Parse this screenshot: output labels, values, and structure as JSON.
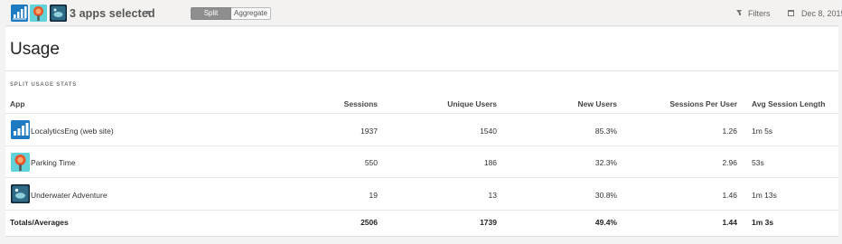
{
  "topbar": {
    "apps_label": "3 apps selected",
    "split_label": "Split",
    "aggregate_label": "Aggregate",
    "filters_label": "Filters",
    "date_label": "Dec 8, 2015"
  },
  "page": {
    "title": "Usage",
    "section_label": "SPLIT USAGE STATS"
  },
  "table": {
    "headers": [
      "App",
      "Sessions",
      "Unique Users",
      "New Users",
      "Sessions Per User",
      "Avg Session Length"
    ],
    "rows": [
      {
        "app": "LocalyticsEng (web site)",
        "icon": "localytics-bars-icon",
        "sessions": "1937",
        "unique_users": "1540",
        "new_users": "85.3%",
        "sessions_per_user": "1.26",
        "avg_session_length": "1m 5s"
      },
      {
        "app": "Parking Time",
        "icon": "parking-meter-icon",
        "sessions": "550",
        "unique_users": "186",
        "new_users": "32.3%",
        "sessions_per_user": "2.96",
        "avg_session_length": "53s"
      },
      {
        "app": "Underwater Adventure",
        "icon": "underwater-game-icon",
        "sessions": "19",
        "unique_users": "13",
        "new_users": "30.8%",
        "sessions_per_user": "1.46",
        "avg_session_length": "1m 13s"
      }
    ],
    "totals": {
      "app": "Totals/Averages",
      "sessions": "2506",
      "unique_users": "1739",
      "new_users": "49.4%",
      "sessions_per_user": "1.44",
      "avg_session_length": "1m 3s"
    }
  },
  "colors": {
    "localytics_blue": "#1f7bc1",
    "parking_orange": "#e8552b",
    "parking_bg": "#5fd3d9",
    "underwater_dark": "#1d3a4a"
  }
}
